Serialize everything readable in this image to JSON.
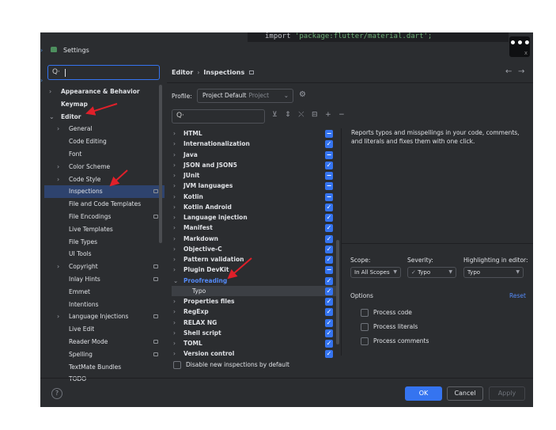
{
  "window": {
    "title": "Settings",
    "code_line": {
      "keyword": "import",
      "string": "'package:flutter/material.dart';"
    },
    "more_label": "•••",
    "close_glyph": "x"
  },
  "sidebar": {
    "search_value": "",
    "items": [
      {
        "label": "Appearance & Behavior",
        "arrow": "›",
        "bold": true
      },
      {
        "label": "Keymap",
        "arrow": "",
        "bold": true
      },
      {
        "label": "Editor",
        "arrow": "⌄",
        "bold": true
      },
      {
        "label": "General",
        "arrow": "›"
      },
      {
        "label": "Code Editing",
        "arrow": ""
      },
      {
        "label": "Font",
        "arrow": ""
      },
      {
        "label": "Color Scheme",
        "arrow": "›"
      },
      {
        "label": "Code Style",
        "arrow": "›"
      },
      {
        "label": "Inspections",
        "arrow": "",
        "selected": true,
        "marker": true
      },
      {
        "label": "File and Code Templates",
        "arrow": ""
      },
      {
        "label": "File Encodings",
        "arrow": "",
        "marker": true
      },
      {
        "label": "Live Templates",
        "arrow": ""
      },
      {
        "label": "File Types",
        "arrow": ""
      },
      {
        "label": "UI Tools",
        "arrow": ""
      },
      {
        "label": "Copyright",
        "arrow": "›",
        "marker": true
      },
      {
        "label": "Inlay Hints",
        "arrow": "",
        "marker": true
      },
      {
        "label": "Emmet",
        "arrow": ""
      },
      {
        "label": "Intentions",
        "arrow": ""
      },
      {
        "label": "Language Injections",
        "arrow": "›",
        "marker": true
      },
      {
        "label": "Live Edit",
        "arrow": ""
      },
      {
        "label": "Reader Mode",
        "arrow": "",
        "marker": true
      },
      {
        "label": "Spelling",
        "arrow": "",
        "marker": true
      },
      {
        "label": "TextMate Bundles",
        "arrow": ""
      },
      {
        "label": "TODO",
        "arrow": ""
      }
    ]
  },
  "header": {
    "crumb_1": "Editor",
    "crumb_sep": "›",
    "crumb_2": "Inspections",
    "back": "←",
    "forward": "→"
  },
  "profile": {
    "label": "Profile:",
    "value": "Project Default",
    "scope": "Project",
    "chevron": "⌄"
  },
  "list": {
    "filter_placeholder": "",
    "toolbar": [
      "⊻",
      "⇕",
      "⤬",
      "⊟",
      "+",
      "−"
    ],
    "items": [
      {
        "label": "HTML",
        "check": "−"
      },
      {
        "label": "Internationalization",
        "check": "✓"
      },
      {
        "label": "Java",
        "check": "−"
      },
      {
        "label": "JSON and JSON5",
        "check": "✓"
      },
      {
        "label": "JUnit",
        "check": "−"
      },
      {
        "label": "JVM languages",
        "check": "−"
      },
      {
        "label": "Kotlin",
        "check": "−"
      },
      {
        "label": "Kotlin Android",
        "check": "✓"
      },
      {
        "label": "Language injection",
        "check": "✓"
      },
      {
        "label": "Manifest",
        "check": "✓"
      },
      {
        "label": "Markdown",
        "check": "✓"
      },
      {
        "label": "Objective-C",
        "check": "✓"
      },
      {
        "label": "Pattern validation",
        "check": "✓"
      },
      {
        "label": "Plugin DevKit",
        "check": "−"
      },
      {
        "label": "Proofreading",
        "check": "✓",
        "expanded": true,
        "link": true
      },
      {
        "label": "Typo",
        "check": "✓",
        "child": true
      },
      {
        "label": "Properties files",
        "check": "✓"
      },
      {
        "label": "RegExp",
        "check": "✓"
      },
      {
        "label": "RELAX NG",
        "check": "✓"
      },
      {
        "label": "Shell script",
        "check": "✓"
      },
      {
        "label": "TOML",
        "check": "✓"
      },
      {
        "label": "Version control",
        "check": "✓"
      }
    ],
    "disable_new_label": "Disable new inspections by default"
  },
  "details": {
    "description": "Reports typos and misspellings in your code, comments, and literals and fixes them with one click.",
    "scope_label": "Scope:",
    "scope_value": "In All Scopes",
    "severity_label": "Severity:",
    "severity_value": "Typo",
    "highlight_label": "Highlighting in editor:",
    "highlight_value": "Typo",
    "options_title": "Options",
    "reset_label": "Reset",
    "options": [
      "Process code",
      "Process literals",
      "Process comments"
    ]
  },
  "footer": {
    "help": "?",
    "ok": "OK",
    "cancel": "Cancel",
    "apply": "Apply"
  },
  "colors": {
    "accent": "#3574f0",
    "link": "#548af7",
    "annotation": "#e0202a",
    "panel_bg": "#2b2d30"
  }
}
